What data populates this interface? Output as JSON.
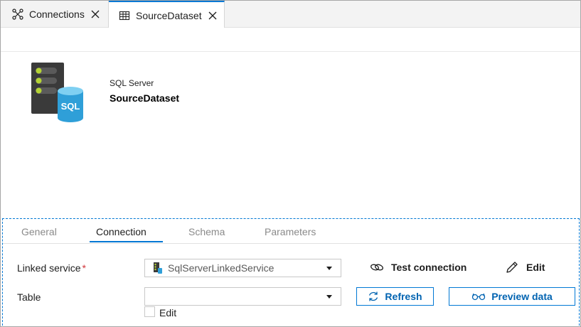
{
  "tabs": [
    {
      "label": "Connections",
      "icon": "connections-icon",
      "active": false
    },
    {
      "label": "SourceDataset",
      "icon": "table-icon",
      "active": true
    }
  ],
  "dataset": {
    "type": "SQL Server",
    "name": "SourceDataset",
    "icon": "sql-server-database-icon"
  },
  "properties_tabs": [
    {
      "label": "General",
      "active": false
    },
    {
      "label": "Connection",
      "active": true
    },
    {
      "label": "Schema",
      "active": false
    },
    {
      "label": "Parameters",
      "active": false
    }
  ],
  "connection": {
    "linked_service_label": "Linked service",
    "required_mark": "*",
    "linked_service_value": "SqlServerLinkedService",
    "test_connection_label": "Test connection",
    "edit_label": "Edit",
    "table_label": "Table",
    "table_value": "",
    "refresh_label": "Refresh",
    "preview_data_label": "Preview data",
    "edit_checkbox_label": "Edit",
    "edit_checkbox_checked": false
  },
  "colors": {
    "accent": "#0078d4",
    "required": "#d13438",
    "sql_icon_body": "#3a3a3a",
    "sql_icon_led": "#b4d334",
    "sql_icon_db": "#50b4e6"
  }
}
